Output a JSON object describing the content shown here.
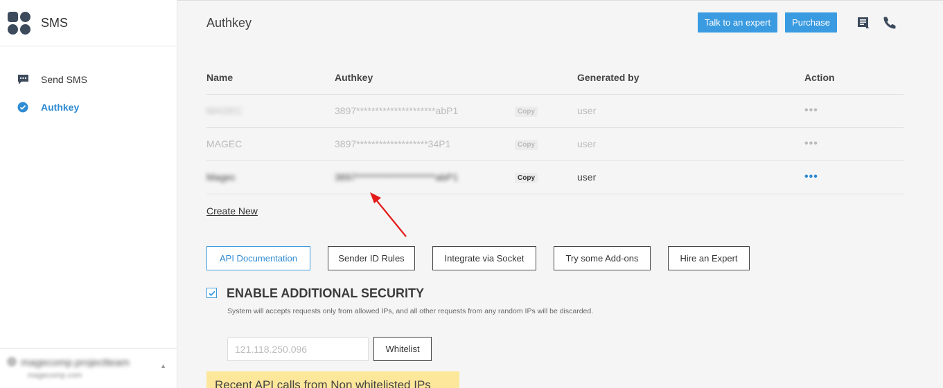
{
  "sidebar": {
    "brand": "SMS",
    "items": [
      {
        "label": "Send SMS",
        "icon": "chat-icon"
      },
      {
        "label": "Authkey",
        "icon": "check-badge-icon"
      }
    ],
    "user": {
      "name": "magecomp.projectteam",
      "sub": "magecomp.com"
    }
  },
  "header": {
    "title": "Authkey",
    "talk_label": "Talk to an expert",
    "purchase_label": "Purchase"
  },
  "table": {
    "columns": [
      "Name",
      "Authkey",
      "Generated by",
      "Action"
    ],
    "rows": [
      {
        "name": "MAGEC",
        "key": "3897*********************abP1",
        "copy": "Copy",
        "generated_by": "user",
        "action": "•••"
      },
      {
        "name": "MAGEC",
        "key": "3897*******************34P1",
        "copy": "Copy",
        "generated_by": "user",
        "action": "•••"
      },
      {
        "name": "Magec",
        "key": "3897*********************abP1",
        "copy": "Copy",
        "generated_by": "user",
        "action": "•••"
      }
    ]
  },
  "create_new": "Create New",
  "buttons": [
    "API Documentation",
    "Sender ID Rules",
    "Integrate via Socket",
    "Try some Add-ons",
    "Hire an Expert"
  ],
  "security": {
    "title": "ENABLE ADDITIONAL SECURITY",
    "checked": true,
    "description": "System will accepts requests only from allowed IPs, and all other requests from any random IPs will be discarded.",
    "ip_placeholder": "121.118.250.096",
    "whitelist_label": "Whitelist"
  },
  "recent_banner": "Recent API calls from Non whitelisted IPs",
  "colors": {
    "accent": "#3a9be0",
    "banner": "#fde79a"
  }
}
